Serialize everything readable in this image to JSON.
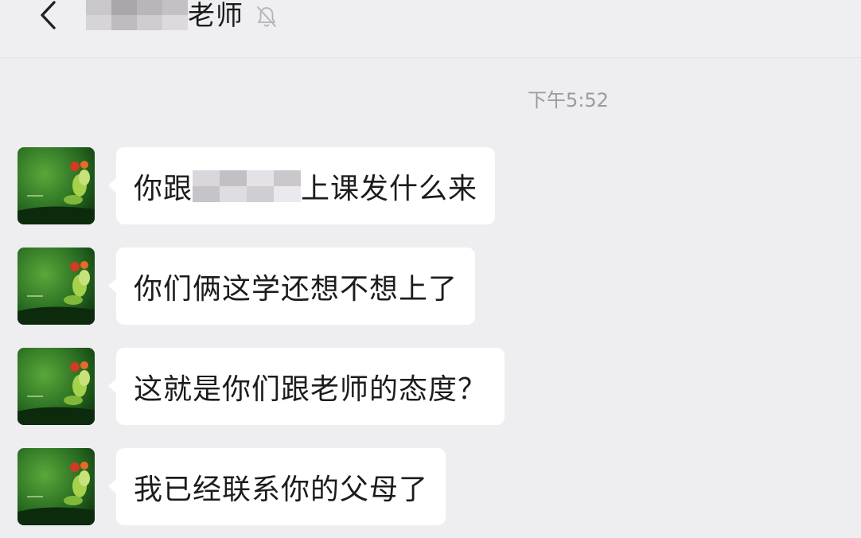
{
  "header": {
    "back_icon": "chevron-left-icon",
    "title_suffix": "老师",
    "mute_icon": "bell-off-icon"
  },
  "timestamp": "下午5:52",
  "messages": [
    {
      "before": "你跟",
      "after": "上课发什么来"
    },
    {
      "text": "你们俩这学还想不想上了"
    },
    {
      "text": "这就是你们跟老师的态度？"
    },
    {
      "text": "我已经联系你的父母了"
    }
  ],
  "colors": {
    "background": "#eeedf0",
    "bubble": "#ffffff",
    "avatar_green": "#2f7a2a",
    "timestamp_text": "#9b9a9d"
  }
}
